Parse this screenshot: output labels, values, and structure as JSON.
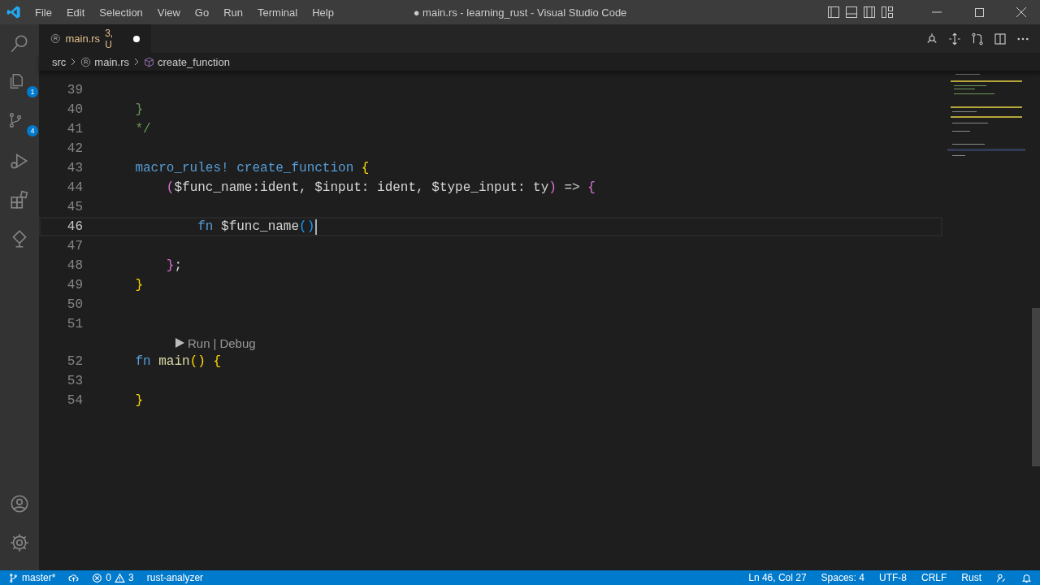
{
  "window": {
    "title": "● main.rs - learning_rust - Visual Studio Code"
  },
  "menu": [
    "File",
    "Edit",
    "Selection",
    "View",
    "Go",
    "Run",
    "Terminal",
    "Help"
  ],
  "activity_bar": {
    "explorer_badge": "1",
    "source_control_badge": "4"
  },
  "tab": {
    "label": "main.rs",
    "status": "3, U",
    "dirty": true
  },
  "breadcrumbs": [
    {
      "label": "src",
      "kind": "folder"
    },
    {
      "label": "main.rs",
      "kind": "file"
    },
    {
      "label": "create_function",
      "kind": "symbol"
    }
  ],
  "editor": {
    "lines": [
      {
        "number": "39",
        "active": false
      },
      {
        "number": "40",
        "active": false,
        "tokens": [
          {
            "text": "    }",
            "kind": "comment"
          }
        ]
      },
      {
        "number": "41",
        "active": false,
        "tokens": [
          {
            "text": "    */",
            "kind": "comment"
          }
        ]
      },
      {
        "number": "42",
        "active": false
      },
      {
        "number": "43",
        "active": false,
        "tokens": [
          {
            "text": "    macro_rules! create_function ",
            "kind": "keyword"
          },
          {
            "text": "{",
            "kind": "bracket1"
          }
        ]
      },
      {
        "number": "44",
        "active": false,
        "tokens": [
          {
            "text": "        (",
            "kind": "bracket2"
          },
          {
            "text": "$func_name:ident, $input: ident, $type_input: ty",
            "kind": "text"
          },
          {
            "text": ")",
            "kind": "bracket2"
          },
          {
            "text": " => ",
            "kind": "text"
          },
          {
            "text": "{",
            "kind": "bracket2"
          }
        ]
      },
      {
        "number": "45",
        "active": false
      },
      {
        "number": "46",
        "active": true,
        "tokens": [
          {
            "text": "            fn ",
            "kind": "keyword"
          },
          {
            "text": "$func_name",
            "kind": "text"
          },
          {
            "text": "()",
            "kind": "bracket3"
          }
        ]
      },
      {
        "number": "47",
        "active": false
      },
      {
        "number": "48",
        "active": false,
        "tokens": [
          {
            "text": "        }",
            "kind": "bracket2"
          },
          {
            "text": ";",
            "kind": "text"
          }
        ]
      },
      {
        "number": "49",
        "active": false,
        "tokens": [
          {
            "text": "    }",
            "kind": "bracket1"
          }
        ]
      },
      {
        "number": "50",
        "active": false
      },
      {
        "number": "51",
        "active": false
      },
      {
        "number": "52",
        "active": false,
        "codelens": {
          "items": [
            "Run",
            "Debug"
          ],
          "separator": "|"
        },
        "tokens": [
          {
            "text": "    fn ",
            "kind": "keyword"
          },
          {
            "text": "main",
            "kind": "function"
          },
          {
            "text": "()",
            "kind": "bracket1"
          },
          {
            "text": " {",
            "kind": "bracket1"
          }
        ]
      },
      {
        "number": "53",
        "active": false
      },
      {
        "number": "54",
        "active": false,
        "tokens": [
          {
            "text": "    }",
            "kind": "bracket1"
          }
        ]
      }
    ]
  },
  "status_bar": {
    "branch": "master*",
    "errors": "0",
    "warnings": "3",
    "language_server": "rust-analyzer",
    "right": [
      "Ln 46, Col 27",
      "Spaces: 4",
      "UTF-8",
      "CRLF",
      "Rust"
    ]
  }
}
